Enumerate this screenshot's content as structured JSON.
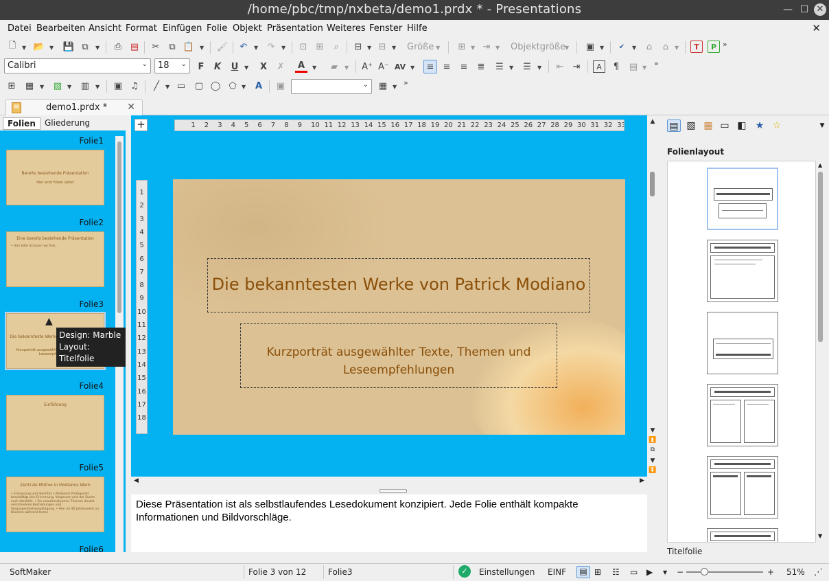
{
  "window": {
    "title": "/home/pbc/tmp/nxbeta/demo1.prdx * - Presentations"
  },
  "menu": [
    "Datei",
    "Bearbeiten",
    "Ansicht",
    "Format",
    "Einfügen",
    "Folie",
    "Objekt",
    "Präsentation",
    "Weiteres",
    "Fenster",
    "Hilfe"
  ],
  "toolbar1": {
    "size_label": "Größe",
    "objsize_label": "Objektgröße"
  },
  "toolbar2": {
    "font": "Calibri",
    "size": "18",
    "bold": "F",
    "italic": "K",
    "underline": "U",
    "strike": "X"
  },
  "tab": {
    "label": "demo1.prdx *"
  },
  "left": {
    "tabs": [
      "Folien",
      "Gliederung"
    ],
    "slides": [
      {
        "label": "Folie1",
        "title": "Bereits bestehende Präsentation",
        "body": "Hier wird Folien lädlet"
      },
      {
        "label": "Folie2",
        "title": "Eine bereits bestehende Präsentation",
        "body": "• Hier bitte Schauen wo find..."
      },
      {
        "label": "Folie3",
        "title": "Die bekannteste Werke von Patrick Modiano",
        "body": "Kurzporträt ausgewählter Texte, Themen und Leseempfehlungen"
      },
      {
        "label": "Folie4",
        "title": "Einführung",
        "body": ""
      },
      {
        "label": "Folie5",
        "title": "Zentrale Motive in Modianos Werk",
        "body": "• Erinnerung und Identität • Modianos Protagonist beschäftigt sich Erinnerung, Vergessen und der Suche nach Identität. • Ein unaufmerksamer Themen deutet verschiedene Bestrebungen und Vergangenheitsbewältigung. • Hier im 40 Jahrhundert zu Bäumen während Rame"
      },
      {
        "label": "Folie6",
        "title": "",
        "body": ""
      }
    ],
    "tooltip": {
      "line1": "Design: Marble",
      "line2": "Layout: Titelfolie"
    }
  },
  "slide": {
    "title": "Die bekanntesten Werke von Patrick Modiano",
    "subtitle": "Kurzporträt ausgewählter Texte, Themen und Leseempfehlungen"
  },
  "notes": {
    "text": "Diese Präsentation ist als selbstlaufendes Lesedokument konzipiert. Jede Folie enthält kompakte Informationen und Bildvorschläge."
  },
  "right": {
    "header": "Folienlayout",
    "footer": "Titelfolie"
  },
  "status": {
    "app": "SoftMaker",
    "page": "Folie 3 von 12",
    "slide": "Folie3",
    "settings": "Einstellungen",
    "mode": "EINF",
    "zoom": "51%"
  },
  "colors": {
    "canvas": "#04b2f2",
    "title_text": "#8a4f08",
    "titlebar": "#3d3d3d"
  }
}
